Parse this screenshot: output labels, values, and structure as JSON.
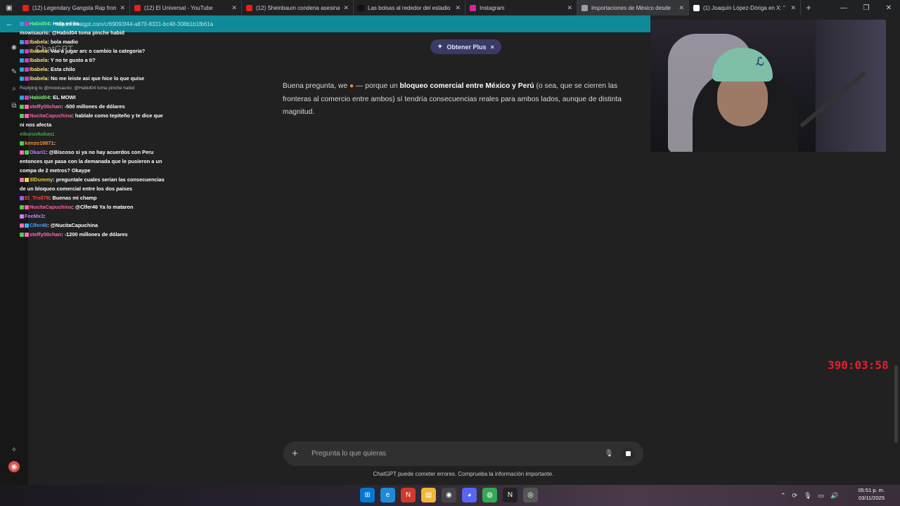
{
  "browser": {
    "tabs": [
      {
        "title": "(12) Legendary Gangsta Rap from",
        "favicon": "youtube-icon",
        "color": "#e62117"
      },
      {
        "title": "(12) El Universal - YouTube",
        "favicon": "youtube-icon",
        "color": "#e62117"
      },
      {
        "title": "(12) Sheinbaum condena asesina",
        "favicon": "youtube-icon",
        "color": "#e62117"
      },
      {
        "title": "Las bolsas al rededor del estadio",
        "favicon": "tiktok-icon",
        "color": "#111111"
      },
      {
        "title": "Instagram",
        "favicon": "instagram-icon",
        "color": "#d6249f"
      },
      {
        "title": "Importaciones de México desde",
        "favicon": "chatgpt-icon",
        "color": "#9aa0a6"
      },
      {
        "title": "(1) Joaquín López-Dóriga en X: \"",
        "favicon": "x-icon",
        "color": "#ffffff"
      }
    ],
    "active_tab": 5,
    "url": "https://chatgpt.com/c/69093f44-a870-8331-bc48-308b1b1fb61a"
  },
  "chatgpt": {
    "brand": "ChatGPT",
    "plus_label": "Obtener Plus",
    "answer_parts": {
      "p1": "Buena pregunta, we ",
      "p2": " — porque un ",
      "bold": "bloqueo comercial entre México y Perú",
      "p3": " (o sea, que se cierren las fronteras al comercio entre ambos) sí tendría consecuencias reales para ambos lados, aunque de distinta magnitud."
    },
    "composer_placeholder": "Pregunta lo que quieras",
    "disclaimer": "ChatGPT puede cometer errores. Comprueba la información importante."
  },
  "stream": {
    "timer": "390:03:58",
    "timer_color": "#e0202a"
  },
  "chat": [
    {
      "user": "Habid04",
      "color": "#7ef27e",
      "text": "Hola mi ko",
      "badges": [
        "#2aa6d6",
        "#c73cc7"
      ]
    },
    {
      "user": "mowisaurio",
      "color": "#ffffff",
      "text": "@Habid04 toma pinche habid",
      "badges": []
    },
    {
      "user": "Ibabela",
      "color": "#f5e06c",
      "text": "bola madio",
      "badges": [
        "#2aa6d6",
        "#c73cc7"
      ]
    },
    {
      "user": "Ibabela",
      "color": "#f5e06c",
      "text": "Vas a jugar arc o cambio la categoria?",
      "badges": [
        "#2aa6d6",
        "#c73cc7"
      ]
    },
    {
      "user": "Ibabela",
      "color": "#f5e06c",
      "text": "Y no te gusto a ti?",
      "badges": [
        "#2aa6d6",
        "#c73cc7"
      ]
    },
    {
      "user": "Ibabela",
      "color": "#f5e06c",
      "text": "Esta chilo",
      "badges": [
        "#2aa6d6",
        "#c73cc7"
      ]
    },
    {
      "user": "Ibabela",
      "color": "#f5e06c",
      "text": "No me leiste asi que hice lo que quise",
      "badges": [
        "#2aa6d6",
        "#c73cc7"
      ]
    },
    {
      "reply": "Replying to @mowisaurio: @Habid04 toma pinche habid"
    },
    {
      "user": "Habid04",
      "color": "#7ef27e",
      "text": "EL MOWI",
      "badges": [
        "#2aa6d6",
        "#c73cc7"
      ]
    },
    {
      "user": "steffy00chan",
      "color": "#ff6bb5",
      "text": "-500 millones de dólares",
      "badges": [
        "#4ccf4c",
        "#ff6bb5"
      ]
    },
    {
      "user": "NucitaCapuchina",
      "color": "#ff5ea8",
      "text": "hablale como tepiteño y te dice que ni nos afecta",
      "badges": [
        "#4ccf4c",
        "#ff5ea8"
      ]
    },
    {
      "user": "eikuruvkakas",
      "color": "#3ea83e",
      "text": "",
      "badges": []
    },
    {
      "user": "kenzo19871",
      "color": "#ff8c3a",
      "text": "",
      "badges": [
        "#4ccf4c"
      ]
    },
    {
      "user": "Okari1",
      "color": "#c77dff",
      "text": "@Biscoso si ya no hay acuerdos con Peru entonces que pasa con la demanada que le pusieron a un compa de 2 metros? Okaype",
      "badges": [
        "#ff6bb5",
        "#4ccf4c"
      ]
    },
    {
      "user": "3lDummy",
      "color": "#e5d24a",
      "text": "preguntale cuales serian las consecuencias de un bloqueo comercial entre los dos paises",
      "badges": [
        "#ff6bb5",
        "#e5d24a"
      ]
    },
    {
      "user": "El_Troll78",
      "color": "#ff4a3a",
      "text": "Buenas mi champ",
      "badges": [
        "#9c5cff"
      ]
    },
    {
      "user": "NucitaCapuchina",
      "color": "#ff5ea8",
      "text": "@Clfer46 Ya lo mataron",
      "badges": [
        "#4ccf4c",
        "#ff5ea8"
      ]
    },
    {
      "user": "FeeMx3",
      "color": "#c77dff",
      "text": "",
      "badges": [
        "#c77dff"
      ]
    },
    {
      "user": "Clfer46",
      "color": "#4aa3ff",
      "text": "@NucitaCapuchina",
      "badges": [
        "#ff6bb5",
        "#4aa3ff"
      ]
    },
    {
      "user": "steffy00chan",
      "color": "#ff6bb5",
      "text": "-1200 millones de dólares",
      "badges": [
        "#4ccf4c",
        "#ff6bb5"
      ]
    }
  ],
  "taskbar": {
    "apps": [
      "windows-start-icon",
      "edge-icon",
      "news-icon",
      "file-explorer-icon",
      "obs-icon",
      "discord-icon",
      "chrome-icon",
      "notion-icon",
      "obs-studio-icon"
    ],
    "time": "05:51 p. m.",
    "date": "03/11/2025"
  }
}
